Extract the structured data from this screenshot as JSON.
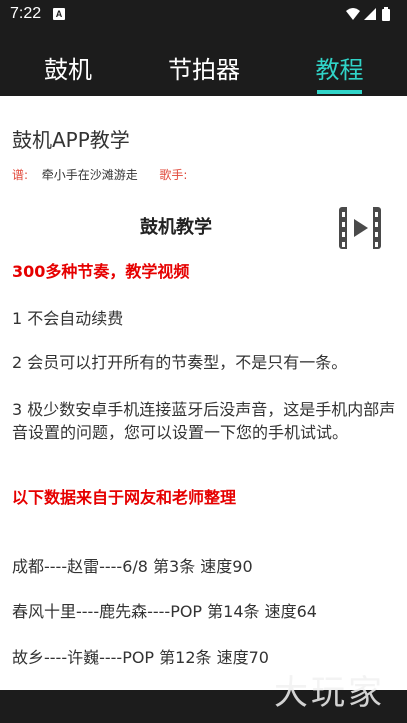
{
  "status_bar": {
    "time": "7:22",
    "notification_letter": "A"
  },
  "tabs": [
    {
      "label": "鼓机",
      "active": false
    },
    {
      "label": "节拍器",
      "active": false
    },
    {
      "label": "教程",
      "active": true
    }
  ],
  "colors": {
    "accent": "#30d4c8",
    "dark_bg": "#1c1c1c",
    "highlight_red": "#e60000",
    "meta_label": "#e0483a"
  },
  "article": {
    "title": "鼓机APP教学",
    "meta": {
      "lyricist_label": "谱:",
      "lyricist_value": "牵小手在沙滩游走",
      "singer_label": "歌手:"
    },
    "section_heading": "鼓机教学",
    "video_icon": "video-play-icon",
    "highlight_1": "300多种节奏，教学视频",
    "para_1": "1 不会自动续费",
    "para_2": "2 会员可以打开所有的节奏型，不是只有一条。",
    "para_3": "3 极少数安卓手机连接蓝牙后没声音，这是手机内部声音设置的问题，您可以设置一下您的手机试试。",
    "highlight_2": "以下数据来自于网友和老师整理",
    "songs": [
      "成都----赵雷----6/8 第3条 速度90",
      "春风十里----鹿先森----POP 第14条 速度64",
      "故乡----许巍----POP   第12条 速度70"
    ]
  },
  "watermark": "大玩家"
}
